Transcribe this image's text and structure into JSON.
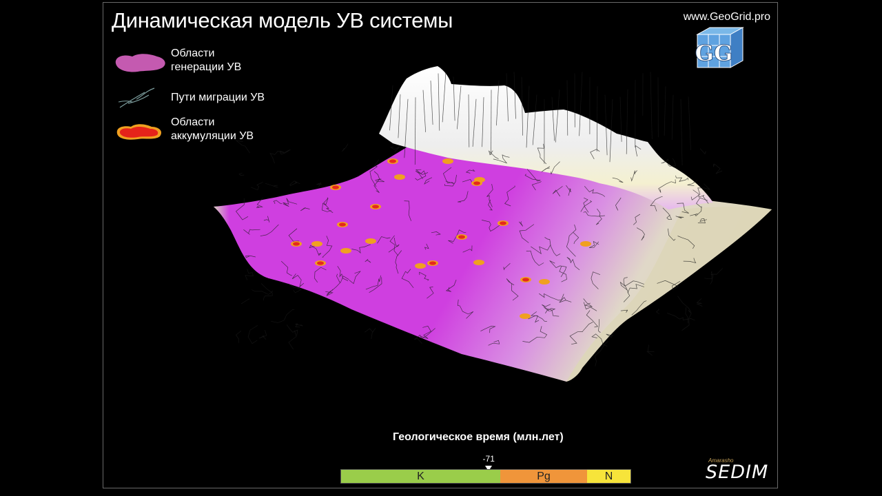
{
  "header": {
    "title": "Динамическая модель УВ системы",
    "website": "www.GeoGrid.pro",
    "logo_text": "GG"
  },
  "legend": {
    "items": [
      {
        "label_line1": "Области",
        "label_line2": "генерации УВ",
        "icon": "generation-area-icon",
        "color": "#c45ab0"
      },
      {
        "label_line1": "Пути миграции УВ",
        "label_line2": "",
        "icon": "migration-paths-icon",
        "color": "#7fa0a0"
      },
      {
        "label_line1": "Области",
        "label_line2": "аккумуляции УВ",
        "icon": "accumulation-area-icon",
        "color": "#e8231c"
      }
    ]
  },
  "surface_colors": {
    "generation": "#cf3fe0",
    "highland": "#f2f2f2",
    "lowland": "#d9d4b4",
    "accumulation": "#e5281c",
    "accumulation_rim": "#f0a020"
  },
  "timeline": {
    "label": "Геологическое время (млн.лет)",
    "marker_value": "-71",
    "marker_fraction": 0.51,
    "periods": [
      {
        "name": "K",
        "fraction": 0.55,
        "color": "#9acd4a"
      },
      {
        "name": "Pg",
        "fraction": 0.3,
        "color": "#f0953a"
      },
      {
        "name": "N",
        "fraction": 0.15,
        "color": "#f7e43a"
      }
    ]
  },
  "brand": {
    "small": "Amarasho",
    "name": "SEDIM"
  }
}
